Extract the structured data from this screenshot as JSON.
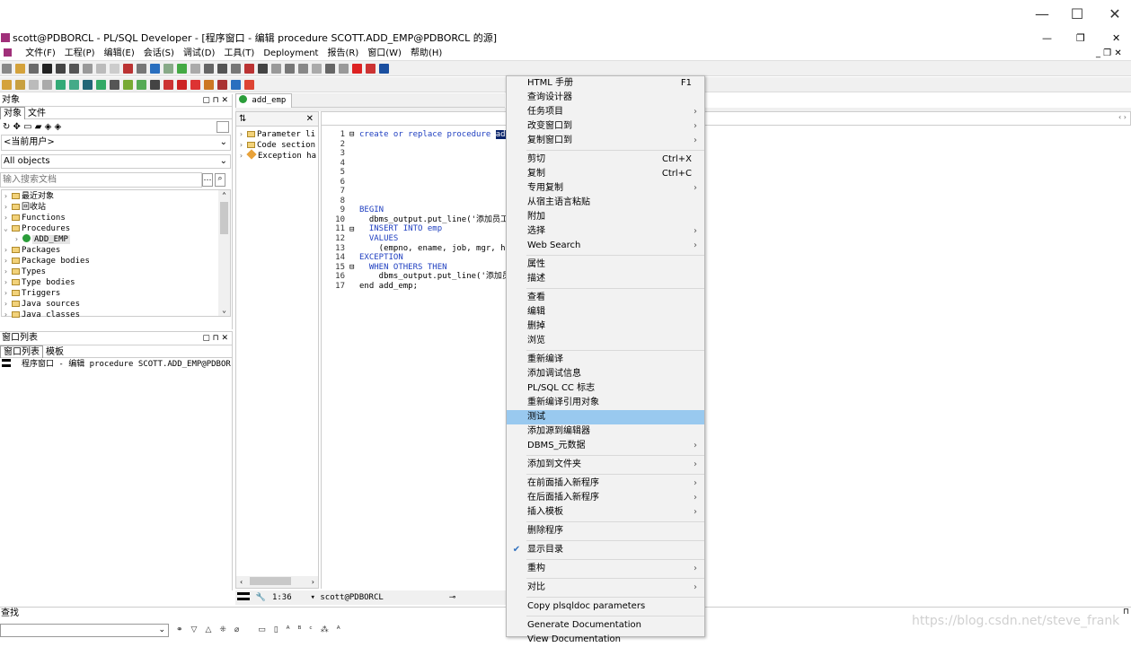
{
  "window": {
    "minimize_icon": "—",
    "maximize_icon": "☐",
    "close_icon": "✕"
  },
  "app": {
    "title": "scott@PDBORCL - PL/SQL Developer - [程序窗口 - 编辑 procedure SCOTT.ADD_EMP@PDBORCL 的源]"
  },
  "menubar": {
    "items": [
      "文件(F)",
      "工程(P)",
      "编辑(E)",
      "会话(S)",
      "调试(D)",
      "工具(T)",
      "Deployment",
      "报告(R)",
      "窗口(W)",
      "帮助(H)"
    ]
  },
  "object_panel": {
    "title": "对象",
    "tabs": [
      "对象",
      "文件"
    ],
    "user_filter": "<当前用户>",
    "object_filter": "All objects",
    "search_placeholder": "输入搜索文档",
    "tree": [
      {
        "label": "最近对象",
        "expanded": false,
        "level": 0
      },
      {
        "label": "回收站",
        "expanded": false,
        "level": 0
      },
      {
        "label": "Functions",
        "expanded": false,
        "level": 0
      },
      {
        "label": "Procedures",
        "expanded": true,
        "level": 0
      },
      {
        "label": "ADD_EMP",
        "expanded": false,
        "level": 1
      },
      {
        "label": "Packages",
        "expanded": false,
        "level": 0
      },
      {
        "label": "Package bodies",
        "expanded": false,
        "level": 0
      },
      {
        "label": "Types",
        "expanded": false,
        "level": 0
      },
      {
        "label": "Type bodies",
        "expanded": false,
        "level": 0
      },
      {
        "label": "Triggers",
        "expanded": false,
        "level": 0
      },
      {
        "label": "Java sources",
        "expanded": false,
        "level": 0
      },
      {
        "label": "Java classes",
        "expanded": false,
        "level": 0
      }
    ]
  },
  "window_list": {
    "title": "窗口列表",
    "tabs": [
      "窗口列表",
      "模板"
    ],
    "items": [
      "程序窗口 - 编辑 procedure SCOTT.ADD_EMP@PDBOR"
    ]
  },
  "editor": {
    "tab_label": "add_emp",
    "outline": [
      "Parameter li",
      "Code section",
      "Exception ha"
    ],
    "lines": [
      "1",
      "2",
      "3",
      "4",
      "5",
      "6",
      "7",
      "8",
      "9",
      "10",
      "11",
      "12",
      "13",
      "14",
      "15",
      "16",
      "17"
    ],
    "code": [
      "create or replace procedure add",
      "",
      "",
      "",
      "",
      "",
      "",
      "",
      "BEGIN",
      "  dbms_output.put_line('添加员工",
      "  INSERT INTO emp",
      "  VALUES",
      "    (empno, ename, job, mgr, hi",
      "EXCEPTION",
      "  WHEN OTHERS THEN",
      "    dbms_output.put_line('添加员",
      "end add_emp;"
    ]
  },
  "status": {
    "position": "1:36",
    "connection": "scott@PDBORCL"
  },
  "find": {
    "label": "查找"
  },
  "context_menu": {
    "items": [
      {
        "label": "HTML 手册",
        "shortcut": "F1"
      },
      {
        "label": "查询设计器"
      },
      {
        "label": "任务项目",
        "submenu": true
      },
      {
        "label": "改变窗口到",
        "submenu": true
      },
      {
        "label": "复制窗口到",
        "submenu": true
      },
      {
        "sep": true
      },
      {
        "label": "剪切",
        "shortcut": "Ctrl+X"
      },
      {
        "label": "复制",
        "shortcut": "Ctrl+C"
      },
      {
        "label": "专用复制",
        "submenu": true
      },
      {
        "label": "从宿主语言粘贴"
      },
      {
        "label": "附加"
      },
      {
        "label": "选择",
        "submenu": true
      },
      {
        "label": "Web Search",
        "submenu": true
      },
      {
        "sep": true
      },
      {
        "label": "属性"
      },
      {
        "label": "描述"
      },
      {
        "sep": true
      },
      {
        "label": "查看"
      },
      {
        "label": "编辑"
      },
      {
        "label": "删掉"
      },
      {
        "label": "浏览"
      },
      {
        "sep": true
      },
      {
        "label": "重新编译"
      },
      {
        "label": "添加调试信息"
      },
      {
        "label": "PL/SQL CC 标志"
      },
      {
        "label": "重新编译引用对象"
      },
      {
        "label": "测试",
        "highlighted": true
      },
      {
        "label": "添加源到编辑器"
      },
      {
        "label": "DBMS_元数据",
        "submenu": true
      },
      {
        "sep": true
      },
      {
        "label": "添加到文件夹",
        "submenu": true
      },
      {
        "sep": true
      },
      {
        "label": "在前面插入新程序",
        "submenu": true
      },
      {
        "label": "在后面插入新程序",
        "submenu": true
      },
      {
        "label": "插入模板",
        "submenu": true
      },
      {
        "sep": true
      },
      {
        "label": "删除程序"
      },
      {
        "sep": true
      },
      {
        "label": "显示目录",
        "checked": true
      },
      {
        "sep": true
      },
      {
        "label": "重构",
        "submenu": true
      },
      {
        "sep": true
      },
      {
        "label": "对比",
        "submenu": true
      },
      {
        "sep": true
      },
      {
        "label": "Copy plsqldoc parameters"
      },
      {
        "sep": true
      },
      {
        "label": "Generate Documentation"
      },
      {
        "label": "View Documentation"
      }
    ]
  },
  "watermark": "https://blog.csdn.net/steve_frank",
  "colors": {
    "accent": "#99c9ef",
    "highlight_bg": "#0a246a"
  }
}
